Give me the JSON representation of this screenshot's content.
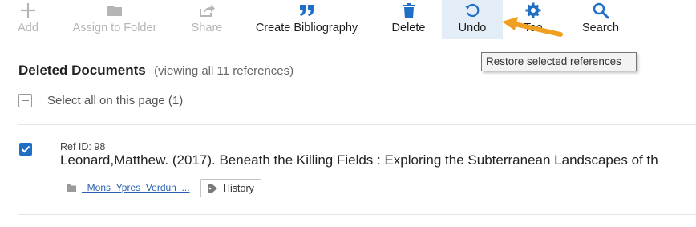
{
  "toolbar": {
    "add": "Add",
    "assign_to_folder": "Assign to Folder",
    "share": "Share",
    "create_bibliography": "Create Bibliography",
    "delete": "Delete",
    "undo": "Undo",
    "tools_partial": "Too",
    "search": "Search"
  },
  "tooltip": "Restore selected references",
  "list": {
    "title": "Deleted Documents",
    "subtitle": "(viewing all 11 references)",
    "select_all": "Select all on this page (1)"
  },
  "reference": {
    "ref_id": "Ref ID: 98",
    "title": "Leonard,Matthew. (2017). Beneath the Killing Fields : Exploring the Subterranean Landscapes of th",
    "folder": "_Mons_Ypres_Verdun_...",
    "tag": "History",
    "checked": true
  },
  "colors": {
    "accent": "#1f6fc5",
    "active_bg": "#e3edf7",
    "arrow": "#f0a020"
  },
  "icons": [
    "plus-icon",
    "folder-icon",
    "share-icon",
    "quote-icon",
    "trash-icon",
    "undo-icon",
    "gear-icon",
    "search-icon",
    "checkbox-checked-icon",
    "folder-small-icon",
    "tag-icon",
    "arrow-annotation-icon"
  ]
}
